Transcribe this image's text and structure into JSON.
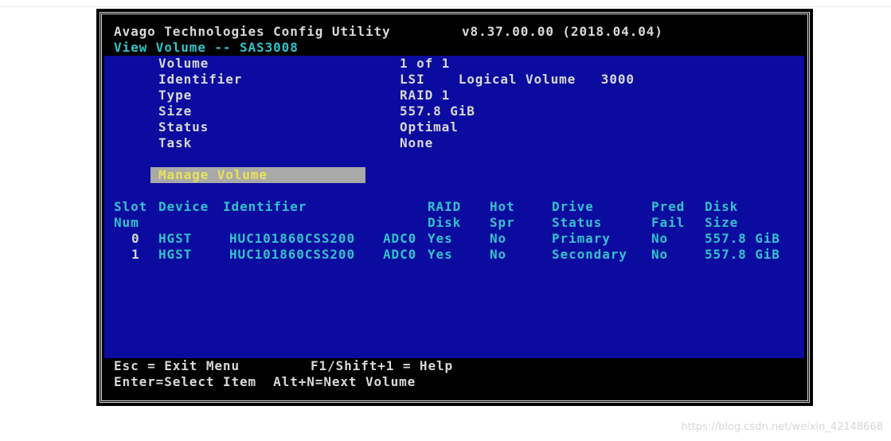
{
  "header": {
    "title": "Avago Technologies Config Utility",
    "version": "v8.37.00.00 (2018.04.04)",
    "subtitle": "View Volume -- SAS3008"
  },
  "volume_info": [
    {
      "label": "Volume",
      "value": "1 of 1"
    },
    {
      "label": "Identifier",
      "value": "LSI    Logical Volume   3000"
    },
    {
      "label": "Type",
      "value": "RAID 1"
    },
    {
      "label": "Size",
      "value": "557.8 GiB"
    },
    {
      "label": "Status",
      "value": "Optimal"
    },
    {
      "label": "Task",
      "value": "None"
    }
  ],
  "menu": {
    "manage_volume": "Manage Volume"
  },
  "table": {
    "headers_row1": {
      "slot": "Slot",
      "device": "Device",
      "identifier": "Identifier",
      "raid": "RAID",
      "hot": "Hot",
      "drive": "Drive",
      "pred": "Pred",
      "disk": "Disk"
    },
    "headers_row2": {
      "slot": "Num",
      "raid": "Disk",
      "hot": "Spr",
      "drive": "Status",
      "pred": "Fail",
      "disk": "Size"
    },
    "rows": [
      {
        "slot": "0",
        "vendor": "HGST",
        "model": "HUC101860CSS200",
        "rev": "ADC0",
        "raid_disk": "Yes",
        "hot_spare": "No",
        "status": "Primary",
        "pred_fail": "No",
        "size": "557.8 GiB"
      },
      {
        "slot": "1",
        "vendor": "HGST",
        "model": "HUC101860CSS200",
        "rev": "ADC0",
        "raid_disk": "Yes",
        "hot_spare": "No",
        "status": "Secondary",
        "pred_fail": "No",
        "size": "557.8 GiB"
      }
    ]
  },
  "footer": {
    "line1a": "Esc = Exit Menu",
    "line1b": "F1/Shift+1 = Help",
    "line2": "Enter=Select Item  Alt+N=Next Volume"
  },
  "watermark": "https://blog.csdn.net/weixin_42148668",
  "colors": {
    "background": "#0b0b9f",
    "header_text": "#d8d8d8",
    "cyan": "#31c3c8",
    "highlight": "#a9a9a9",
    "highlight_text": "#e8e35a"
  }
}
